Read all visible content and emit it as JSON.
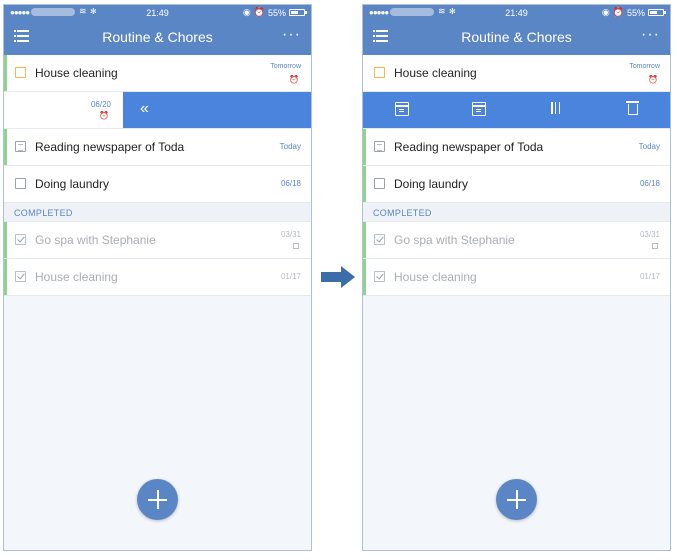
{
  "status_bar": {
    "signal": "●●●●●",
    "time": "21:49",
    "battery": "55%"
  },
  "header": {
    "title": "Routine & Chores",
    "more": "···"
  },
  "icons": {
    "menu": "hamburger-icon",
    "more": "more-icon",
    "alarm": "alarm-clock-icon",
    "swipe_back": "double-chevron-left-icon",
    "fab": "plus-icon",
    "arrow": "right-arrow-icon"
  },
  "colors": {
    "header": "#5b86c5",
    "swipe": "#4a84dc",
    "accent_green": "#8fd38c",
    "orange": "#f0b84e",
    "arrow": "#3b6ea8"
  },
  "left_screen": {
    "task1": {
      "text": "House cleaning",
      "date": "Tomorrow"
    },
    "swipe": {
      "date": "06/20",
      "chevron": "«"
    },
    "task2": {
      "text": "Reading newspaper of Toda",
      "date": "Today"
    },
    "task3": {
      "text": "Doing laundry",
      "date": "06/18"
    },
    "section": "COMPLETED",
    "done1": {
      "text": "Go spa with Stephanie",
      "date": "03/31"
    },
    "done2": {
      "text": "House cleaning",
      "date": "01/17"
    }
  },
  "right_screen": {
    "task1": {
      "text": "House cleaning",
      "date": "Tomorrow"
    },
    "actions": [
      "calendar-icon",
      "date-picker-icon",
      "priority-bars-icon",
      "trash-icon"
    ],
    "task2": {
      "text": "Reading newspaper of Toda",
      "date": "Today"
    },
    "task3": {
      "text": "Doing laundry",
      "date": "06/18"
    },
    "section": "COMPLETED",
    "done1": {
      "text": "Go spa with Stephanie",
      "date": "03/31"
    },
    "done2": {
      "text": "House cleaning",
      "date": "01/17"
    }
  }
}
